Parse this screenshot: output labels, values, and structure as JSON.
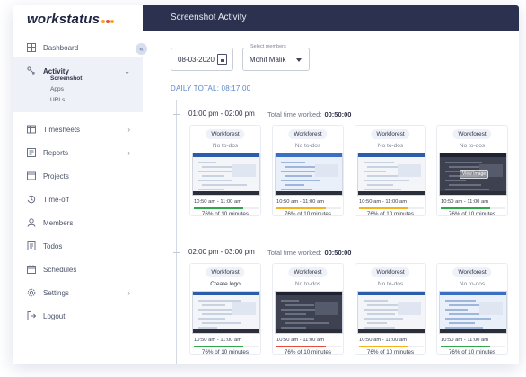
{
  "brand": {
    "name": "workstatus",
    "dot_colors": [
      "#f5a623",
      "#e84c3d",
      "#f5a623"
    ]
  },
  "sidebar": {
    "items": [
      {
        "key": "dashboard",
        "label": "Dashboard",
        "icon": "dashboard-icon"
      },
      {
        "key": "activity",
        "label": "Activity",
        "icon": "activity-icon",
        "expanded": true,
        "sub": [
          "Screenshot",
          "Apps",
          "URLs"
        ]
      },
      {
        "key": "timesheets",
        "label": "Timesheets",
        "icon": "timesheets-icon",
        "chevron": true
      },
      {
        "key": "reports",
        "label": "Reports",
        "icon": "reports-icon",
        "chevron": true
      },
      {
        "key": "projects",
        "label": "Projects",
        "icon": "projects-icon"
      },
      {
        "key": "timeoff",
        "label": "Time-off",
        "icon": "timeoff-icon"
      },
      {
        "key": "members",
        "label": "Members",
        "icon": "members-icon"
      },
      {
        "key": "todos",
        "label": "Todos",
        "icon": "todos-icon"
      },
      {
        "key": "schedules",
        "label": "Schedules",
        "icon": "schedules-icon"
      },
      {
        "key": "settings",
        "label": "Settings",
        "icon": "settings-icon",
        "chevron": true
      },
      {
        "key": "logout",
        "label": "Logout",
        "icon": "logout-icon"
      }
    ]
  },
  "header": {
    "title": "Screenshot Activity"
  },
  "filters": {
    "date": "08-03-2020",
    "member_label": "Select members",
    "member_value": "Mohit Malik"
  },
  "daily_total": "DAILY TOTAL: 08:17:00",
  "slots": [
    {
      "time": "01:00 pm - 02:00 pm",
      "total_label": "Total time worked:",
      "total": "00:50:00",
      "cards": [
        {
          "project": "Workforest",
          "todo": "No to-dos",
          "range": "10:50 am - 11:00 am",
          "percent": "76% of 10 minutes",
          "activity": 0.76,
          "bar_color": "#2ea84a",
          "theme": "light"
        },
        {
          "project": "Workforest",
          "todo": "No to-dos",
          "range": "10:50 am - 11:00 am",
          "percent": "76% of 10 minutes",
          "activity": 0.76,
          "bar_color": "#f5b21f",
          "theme": "blue"
        },
        {
          "project": "Workforest",
          "todo": "No to-dos",
          "range": "10:50 am - 11:00 am",
          "percent": "76% of 10 minutes",
          "activity": 0.76,
          "bar_color": "#f5b21f",
          "theme": "light"
        },
        {
          "project": "Workforest",
          "todo": "No to-dos",
          "range": "10:50 am - 11:00 am",
          "percent": "76% of 10 minutes",
          "activity": 0.76,
          "bar_color": "#2ea84a",
          "theme": "dark",
          "overlay": "View Image"
        }
      ]
    },
    {
      "time": "02:00 pm - 03:00 pm",
      "total_label": "Total time worked:",
      "total": "00:50:00",
      "cards": [
        {
          "project": "Workforest",
          "todo": "Create logo",
          "range": "10:50 am - 11:00 am",
          "percent": "76% of 10 minutes",
          "activity": 0.76,
          "bar_color": "#2ea84a",
          "theme": "light",
          "todo_dark": true
        },
        {
          "project": "Workforest",
          "todo": "No to-dos",
          "range": "10:50 am - 11:00 am",
          "percent": "76% of 10 minutes",
          "activity": 0.76,
          "bar_color": "#e84c3d",
          "theme": "dark"
        },
        {
          "project": "Workforest",
          "todo": "No to-dos",
          "range": "10:50 am - 11:00 am",
          "percent": "76% of 10 minutes",
          "activity": 0.76,
          "bar_color": "#f5b21f",
          "theme": "light"
        },
        {
          "project": "Workforest",
          "todo": "No to-dos",
          "range": "10:50 am - 11:00 am",
          "percent": "76% of 10 minutes",
          "activity": 0.76,
          "bar_color": "#2ea84a",
          "theme": "blue"
        }
      ]
    }
  ]
}
